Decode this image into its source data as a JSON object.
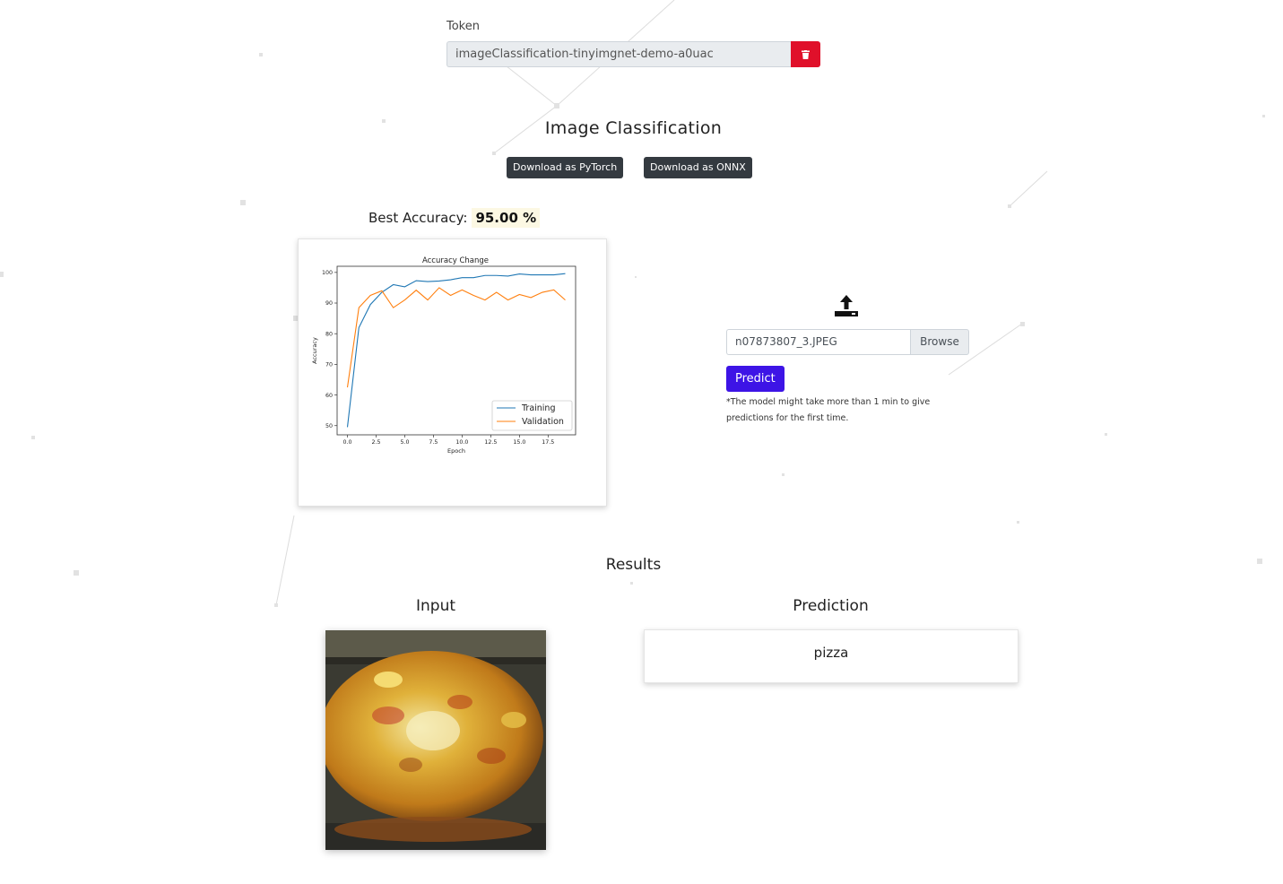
{
  "token": {
    "label": "Token",
    "value": "imageClassification-tinyimgnet-demo-a0uac",
    "delete_icon": "trash-icon",
    "delete_color": "#e0102a"
  },
  "page_title": "Image Classification",
  "downloads": {
    "pytorch_label": "Download as PyTorch",
    "onnx_label": "Download as ONNX"
  },
  "best_accuracy": {
    "label": "Best Accuracy:",
    "value": "95.00 %"
  },
  "chart_data": {
    "type": "line",
    "title": "Accuracy Change",
    "xlabel": "Epoch",
    "ylabel": "Accuracy",
    "xlim": [
      -0.9,
      19.9
    ],
    "ylim": [
      47,
      102
    ],
    "xticks": [
      0.0,
      2.5,
      5.0,
      7.5,
      10.0,
      12.5,
      15.0,
      17.5
    ],
    "xtick_labels": [
      "0.0",
      "2.5",
      "5.0",
      "7.5",
      "10.0",
      "12.5",
      "15.0",
      "17.5"
    ],
    "yticks": [
      50,
      60,
      70,
      80,
      90,
      100
    ],
    "grid": false,
    "legend_position": "lower right",
    "x": [
      0,
      1,
      2,
      3,
      4,
      5,
      6,
      7,
      8,
      9,
      10,
      11,
      12,
      13,
      14,
      15,
      16,
      17,
      18,
      19
    ],
    "series": [
      {
        "name": "Training",
        "color": "#1f77b4",
        "values": [
          49.5,
          82,
          89.5,
          93.5,
          96,
          95.3,
          97.3,
          97,
          97.2,
          97.6,
          98.3,
          98.3,
          99,
          99,
          98.8,
          99.5,
          99.2,
          99.2,
          99.2,
          99.6
        ]
      },
      {
        "name": "Validation",
        "color": "#ff7f0e",
        "values": [
          62.5,
          88.5,
          92.5,
          94,
          88.5,
          91,
          94.2,
          91,
          95,
          92.5,
          94.3,
          92.5,
          91,
          93.5,
          91,
          92.8,
          91.8,
          93.5,
          94.3,
          91
        ]
      }
    ]
  },
  "upload": {
    "icon": "upload-icon",
    "file_name": "n07873807_3.JPEG",
    "browse_label": "Browse",
    "predict_label": "Predict",
    "note": "*The model might take more than 1 min to give predictions for the first time."
  },
  "results": {
    "title": "Results",
    "input_title": "Input",
    "prediction_title": "Prediction",
    "prediction_value": "pizza"
  },
  "colors": {
    "predict_button": "#3d14e6",
    "download_button": "#343a40",
    "accuracy_highlight": "#fcf8e3"
  }
}
